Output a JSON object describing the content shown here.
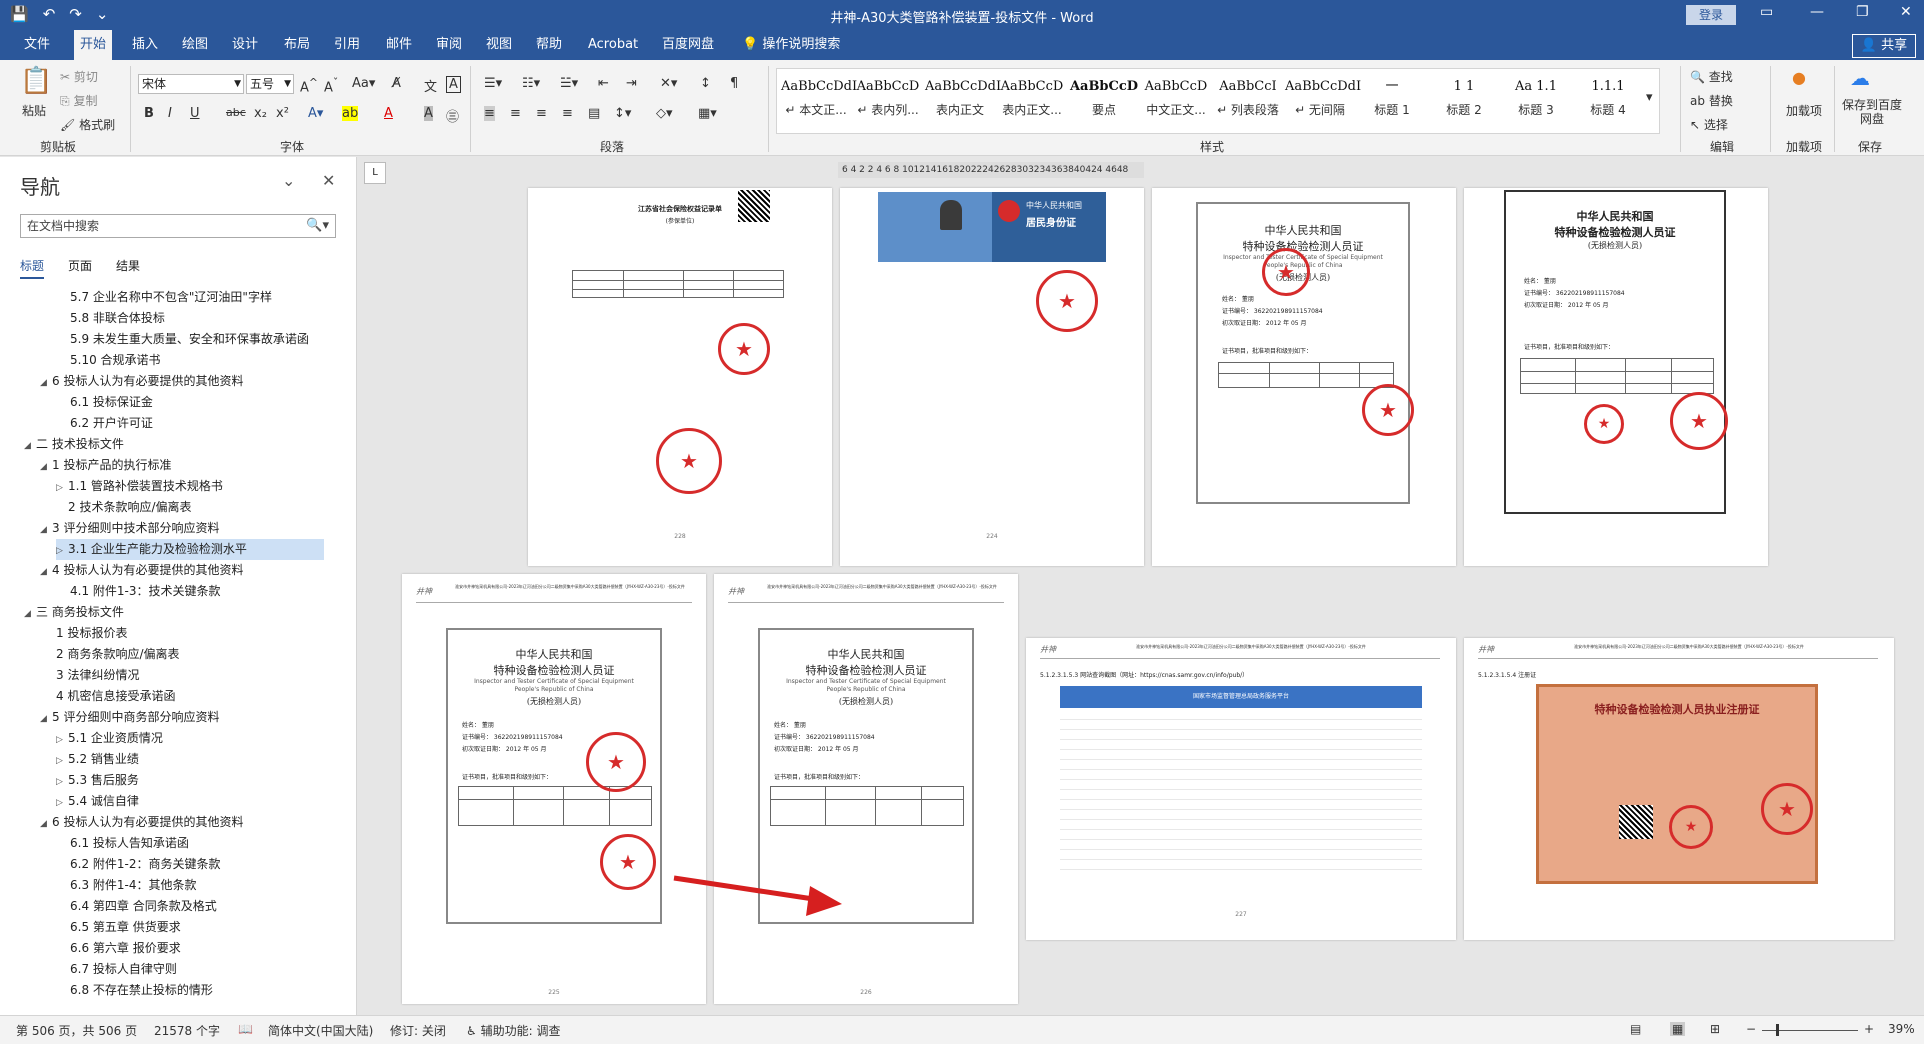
{
  "titlebar": {
    "title": "井神-A30大类管路补偿装置-投标文件 - Word",
    "login": "登录",
    "save_icon": "save-icon",
    "undo_icon": "undo-icon",
    "redo_icon": "redo-icon"
  },
  "tabs": [
    "文件",
    "开始",
    "插入",
    "绘图",
    "设计",
    "布局",
    "引用",
    "邮件",
    "审阅",
    "视图",
    "帮助",
    "Acrobat",
    "百度网盘",
    "操作说明搜索"
  ],
  "share": "共享",
  "ribbon": {
    "clipboard": {
      "paste": "粘贴",
      "cut": "剪切",
      "copy": "复制",
      "format_painter": "格式刷",
      "label": "剪贴板"
    },
    "font": {
      "font_name": "宋体",
      "font_size": "五号",
      "label": "字体"
    },
    "paragraph": {
      "label": "段落"
    },
    "styles": {
      "label": "样式",
      "items": [
        {
          "sample": "AaBbCcDdI",
          "name": "↵ 本文正..."
        },
        {
          "sample": "AaBbCcD",
          "name": "↵ 表内列..."
        },
        {
          "sample": "AaBbCcDdI",
          "name": "表内正文"
        },
        {
          "sample": "AaBbCcD",
          "name": "表内正文..."
        },
        {
          "sample": "AaBbCcD",
          "name": "要点"
        },
        {
          "sample": "AaBbCcD",
          "name": "中文正文..."
        },
        {
          "sample": "AaBbCcI",
          "name": "↵ 列表段落"
        },
        {
          "sample": "AaBbCcDdI",
          "name": "↵ 无间隔"
        },
        {
          "sample": "一",
          "name": "标题 1"
        },
        {
          "sample": "1 1",
          "name": "标题 2"
        },
        {
          "sample": "Aa 1.1",
          "name": "标题 3"
        },
        {
          "sample": "1.1.1",
          "name": "标题 4"
        }
      ]
    },
    "editing": {
      "find": "查找",
      "replace": "替换",
      "select": "选择",
      "label": "编辑"
    },
    "addins": {
      "load": "加载项",
      "label": "加载项"
    },
    "baidu": {
      "save": "保存到百度网盘",
      "label": "保存"
    }
  },
  "nav": {
    "title": "导航",
    "search_placeholder": "在文档中搜索",
    "tabs": [
      "标题",
      "页面",
      "结果"
    ],
    "items": [
      "5.7 企业名称中不包含\"辽河油田\"字样",
      "5.8 非联合体投标",
      "5.9 未发生重大质量、安全和环保事故承诺函",
      "5.10 合规承诺书",
      "6 投标人认为有必要提供的其他资料",
      "6.1 投标保证金",
      "6.2 开户许可证",
      "二 技术投标文件",
      "1 投标产品的执行标准",
      "1.1 管路补偿装置技术规格书",
      "2 技术条款响应/偏离表",
      "3 评分细则中技术部分响应资料",
      "3.1 企业生产能力及检验检测水平",
      "4 投标人认为有必要提供的其他资料",
      "4.1 附件1-3：技术关键条款",
      "三 商务投标文件",
      "1 投标报价表",
      "2 商务条款响应/偏离表",
      "3 法律纠纷情况",
      "4 机密信息接受承诺函",
      "5 评分细则中商务部分响应资料",
      "5.1 企业资质情况",
      "5.2 销售业绩",
      "5.3 售后服务",
      "5.4 诚信自律",
      "6 投标人认为有必要提供的其他资料",
      "6.1 投标人告知承诺函",
      "6.2 附件1-2：商务关键条款",
      "6.3 附件1-4：其他条款",
      "6.4 第四章 合同条款及格式",
      "6.5 第五章 供货要求",
      "6.6 第六章 报价要求",
      "6.7 投标人自律守则",
      "6.8 不存在禁止投标的情形"
    ]
  },
  "ruler": "6 4 2  2 4 6 8 10121416182022242628303234363840424  4648",
  "pages": {
    "p1_title": "江苏省社会保险权益记录单",
    "p1_sub": "(参保单位)",
    "idcard_title": "中华人民共和国",
    "idcard_sub": "居民身份证",
    "cert_title": "中华人民共和国",
    "cert_title2": "特种设备检验检测人员证",
    "cert_en": "Inspector and Tester Certificate of Special Equipment",
    "cert_en2": "People's Republic of China",
    "cert_note": "(无损检测人员)",
    "cert_name": "姓名：  董朋",
    "cert_no": "证书编号：  362202198911157084",
    "cert_date": "初次取证日期：  2012 年 05 月",
    "cert_items": "证书项目，批准项目和级别如下：",
    "header_text": "淮安市井神钻采机具有限公司-2023年辽河油田分公司二级物资集中采购A30大类管路补偿装置（JYHX-WZ-A30-23号）-投标文件",
    "web_title": "5.1.2.3.1.5.3 网站查询截图（网址：https://cnas.samr.gov.cn/info/pub/）",
    "license_title": "5.1.2.3.1.5.4 注册证",
    "license_cert": "特种设备检验检测人员执业注册证",
    "web_banner": "国家市场监督管理总局政务服务平台",
    "page_nums": [
      "228",
      "224",
      "225",
      "226",
      "227"
    ]
  },
  "status": {
    "page": "第 506 页，共 506 页",
    "words": "21578 个字",
    "lang": "简体中文(中国大陆)",
    "track": "修订: 关闭",
    "access": "辅助功能: 调查",
    "zoom": "39%"
  },
  "colors": {
    "brand": "#2b579a",
    "stamp": "#d62b2b",
    "license_bg": "#e8a888"
  }
}
